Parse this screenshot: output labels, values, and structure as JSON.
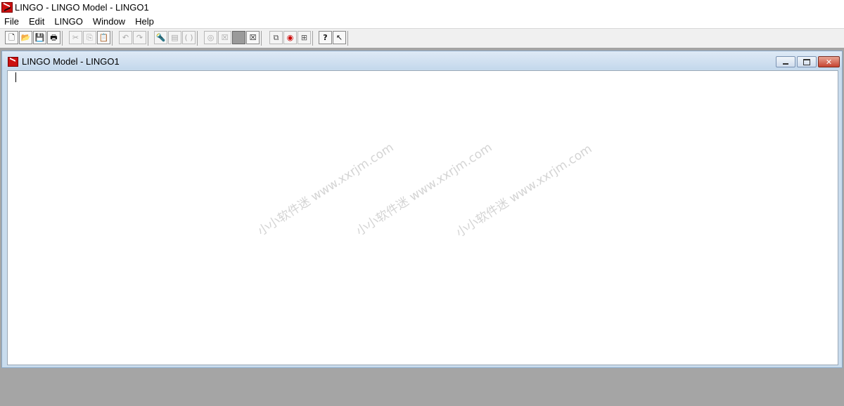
{
  "app": {
    "title": "LINGO - LINGO Model - LINGO1",
    "icon": "lingo-app-icon"
  },
  "menu": {
    "items": [
      "File",
      "Edit",
      "LINGO",
      "Window",
      "Help"
    ]
  },
  "toolbar": {
    "groups": [
      [
        {
          "name": "new-file",
          "glyph": "🗋"
        },
        {
          "name": "open-file",
          "glyph": "📂"
        },
        {
          "name": "save",
          "glyph": "💾"
        },
        {
          "name": "print",
          "glyph": "🖶"
        }
      ],
      [
        {
          "name": "cut",
          "glyph": "✂"
        },
        {
          "name": "copy",
          "glyph": "⎘"
        },
        {
          "name": "paste",
          "glyph": "📋"
        }
      ],
      [
        {
          "name": "undo",
          "glyph": "↶"
        },
        {
          "name": "redo",
          "glyph": "↷"
        }
      ],
      [
        {
          "name": "find",
          "glyph": "🔦"
        },
        {
          "name": "go-to-line",
          "glyph": "▤"
        },
        {
          "name": "match-parenthesis",
          "glyph": "( )"
        }
      ],
      [
        {
          "name": "solve",
          "glyph": "◎"
        },
        {
          "name": "solution",
          "glyph": "☒"
        },
        {
          "name": "stop",
          "glyph": "■"
        },
        {
          "name": "close-all",
          "glyph": "☒"
        }
      ],
      [
        {
          "name": "send-to-back",
          "glyph": "⧉"
        },
        {
          "name": "options",
          "glyph": "◉"
        },
        {
          "name": "tile",
          "glyph": "⊞"
        }
      ],
      [
        {
          "name": "help-topics",
          "glyph": "?"
        },
        {
          "name": "context-help",
          "glyph": "↖"
        }
      ]
    ]
  },
  "document": {
    "title": "LINGO Model - LINGO1",
    "content": ""
  },
  "watermark": {
    "text": "小小软件迷 www.xxrjm.com"
  },
  "colors": {
    "mdi_background": "#a5a5a5",
    "child_frame": "#c9dced",
    "close_button": "#c64430",
    "icon_red": "#cc1111"
  }
}
